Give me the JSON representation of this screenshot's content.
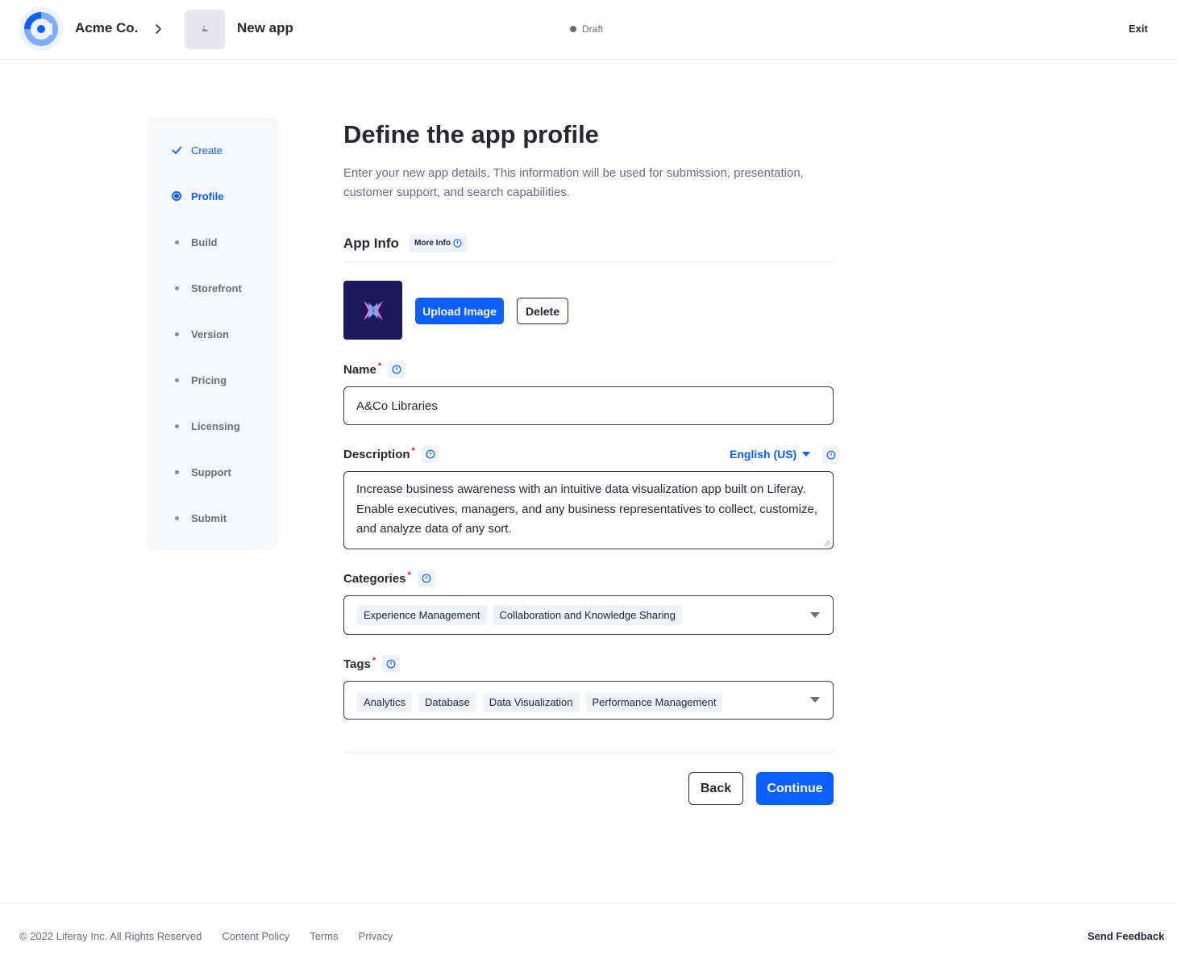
{
  "header": {
    "company": "Acme Co.",
    "app_name": "New app",
    "status": "Draft",
    "exit_label": "Exit"
  },
  "steps": [
    {
      "label": "Create",
      "state": "done"
    },
    {
      "label": "Profile",
      "state": "active"
    },
    {
      "label": "Build",
      "state": "pending"
    },
    {
      "label": "Storefront",
      "state": "pending"
    },
    {
      "label": "Version",
      "state": "pending"
    },
    {
      "label": "Pricing",
      "state": "pending"
    },
    {
      "label": "Licensing",
      "state": "pending"
    },
    {
      "label": "Support",
      "state": "pending"
    },
    {
      "label": "Submit",
      "state": "pending"
    }
  ],
  "main": {
    "title": "Define the app profile",
    "subtitle": "Enter your new app details. This information will be used for submission, presentation, customer support, and search capabilities.",
    "section_title": "App Info",
    "more_info": "More Info",
    "upload_label": "Upload Image",
    "delete_label": "Delete",
    "name_label": "Name",
    "name_value": "A&Co Libraries",
    "description_label": "Description",
    "language": "English (US)",
    "description_value": "Increase business awareness with an intuitive data visualization app built on Liferay. Enable executives, managers, and any business representatives to collect, customize, and analyze data of any sort.",
    "categories_label": "Categories",
    "categories": [
      "Experience Management",
      "Collaboration and Knowledge Sharing"
    ],
    "tags_label": "Tags",
    "tags": [
      "Analytics",
      "Database",
      "Data Visualization",
      "Performance Management"
    ],
    "back_label": "Back",
    "continue_label": "Continue",
    "required_mark": "*"
  },
  "footer": {
    "copyright": "© 2022 Liferay Inc. All Rights Reserved",
    "links": [
      "Content Policy",
      "Terms",
      "Privacy"
    ],
    "feedback": "Send Feedback"
  },
  "colors": {
    "primary": "#0b5fff",
    "text": "#272833",
    "muted": "#6b6c7e",
    "app_icon_bg": "#1c1a5e"
  }
}
